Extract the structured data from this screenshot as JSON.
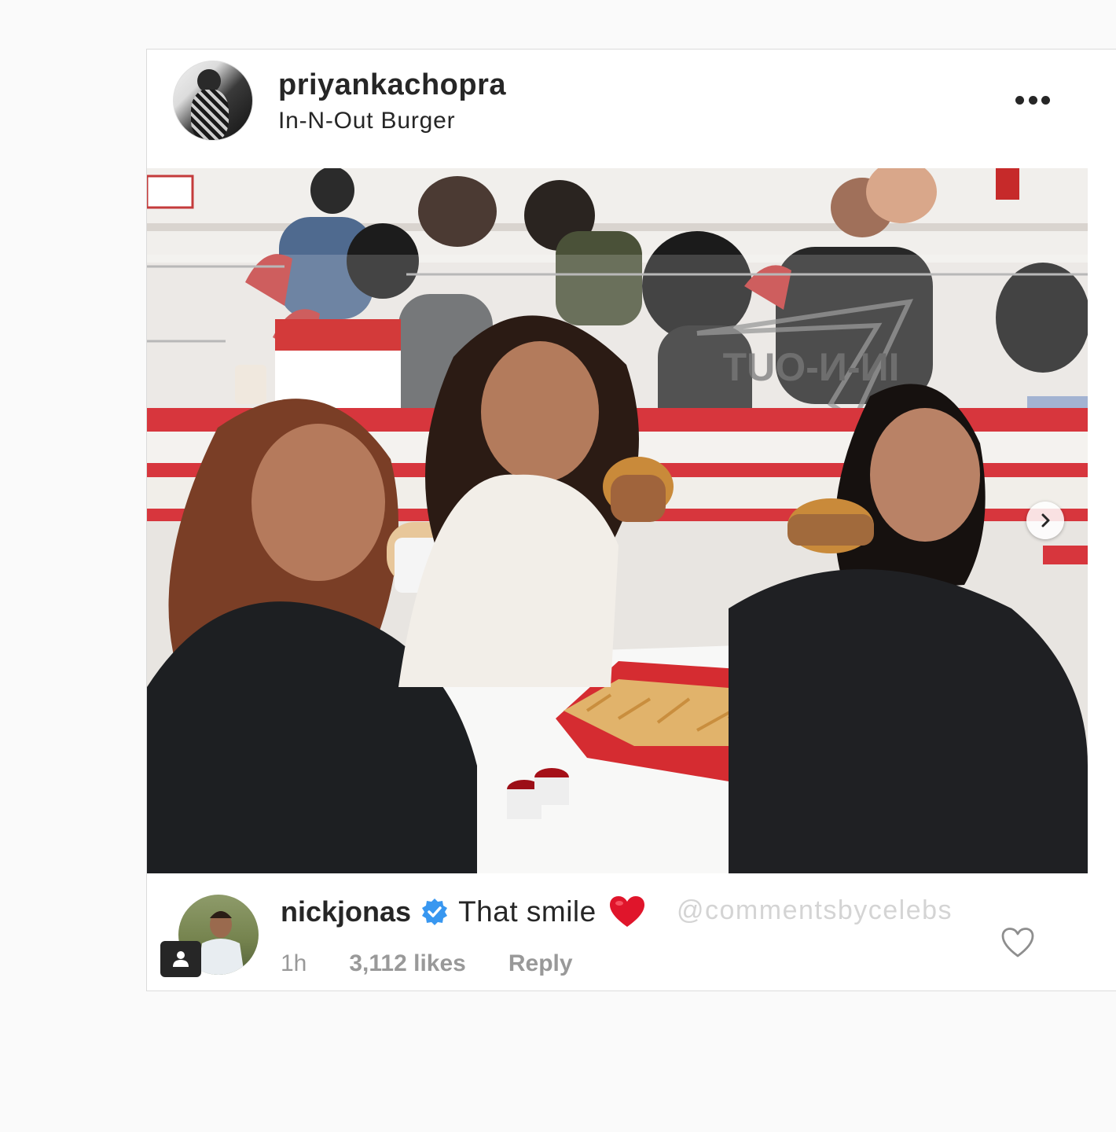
{
  "post": {
    "username": "priyankachopra",
    "location": "In-N-Out Burger",
    "more_icon": "more-horizontal-icon"
  },
  "photo": {
    "sign_text": "IN-N-OUT",
    "carousel_next_icon": "chevron-right-icon"
  },
  "comment": {
    "username": "nickjonas",
    "verified_icon": "verified-badge-icon",
    "text": "That smile",
    "emoji": "red-heart-emoji",
    "watermark": "@commentsbycelebs",
    "time": "1h",
    "likes": "3,112 likes",
    "reply_label": "Reply",
    "like_icon": "heart-outline-icon",
    "tagged_icon": "user-tag-icon"
  },
  "colors": {
    "text_primary": "#262626",
    "text_secondary": "#999999",
    "verified_blue": "#3897f0",
    "heart_red": "#e0152b",
    "watermark": "#d4d4d4"
  }
}
